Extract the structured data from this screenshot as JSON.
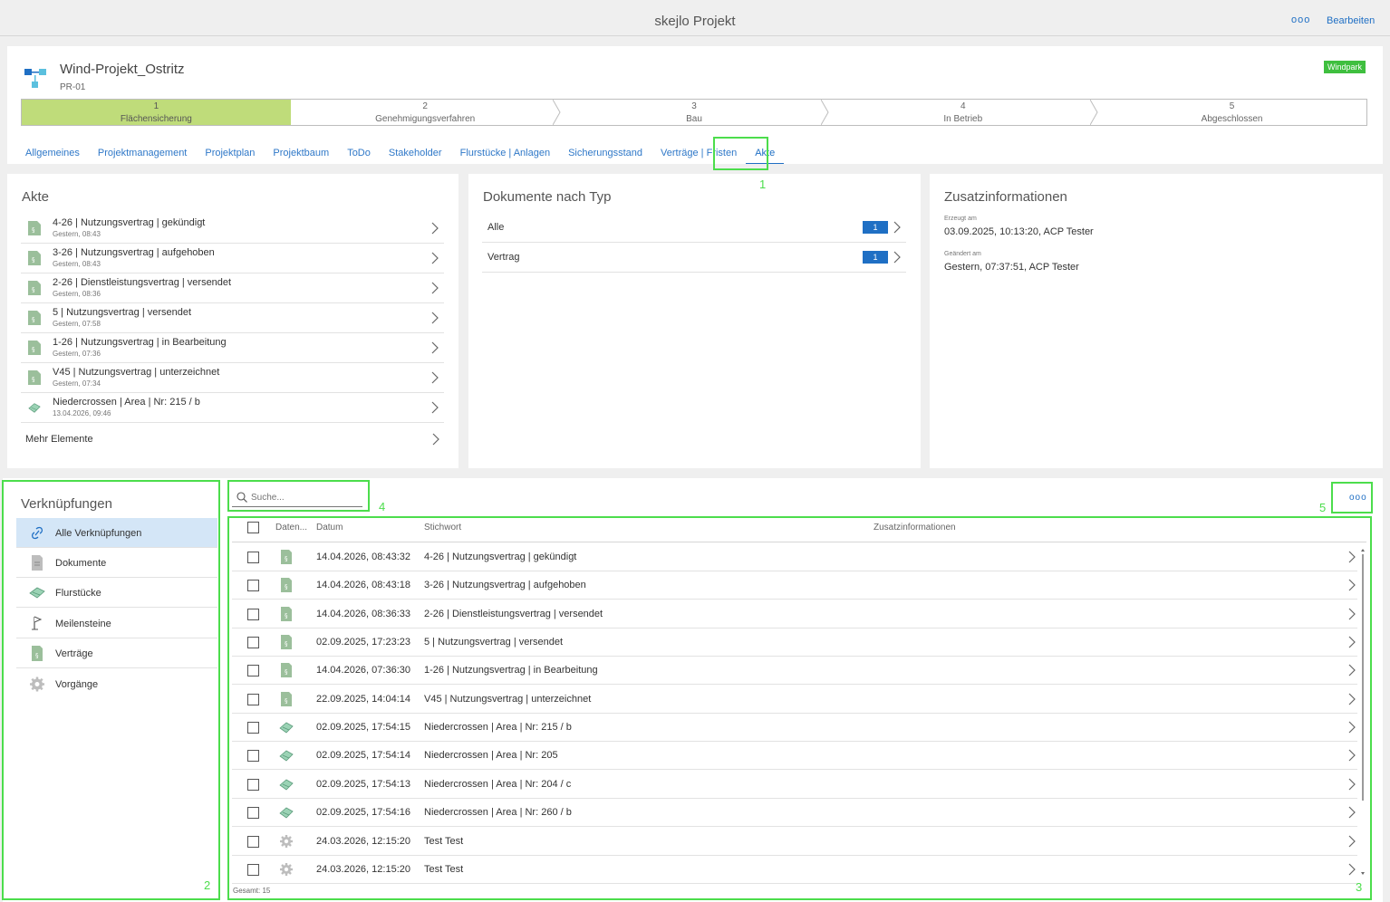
{
  "app": {
    "title": "skejlo Projekt",
    "more_label": "ooo",
    "edit_label": "Bearbeiten"
  },
  "project": {
    "name": "Wind-Projekt_Ostritz",
    "id": "PR-01",
    "badge": "Windpark",
    "badge_color": "#3fbf3f"
  },
  "phases": [
    {
      "num": "1",
      "label": "Flächensicherung",
      "active": true
    },
    {
      "num": "2",
      "label": "Genehmigungsverfahren"
    },
    {
      "num": "3",
      "label": "Bau"
    },
    {
      "num": "4",
      "label": "In Betrieb"
    },
    {
      "num": "5",
      "label": "Abgeschlossen"
    }
  ],
  "tabs": [
    "Allgemeines",
    "Projektmanagement",
    "Projektplan",
    "Projektbaum",
    "ToDo",
    "Stakeholder",
    "Flurstücke | Anlagen",
    "Sicherungsstand",
    "Verträge | Fristen",
    "Akte"
  ],
  "annotations": [
    "1",
    "2",
    "3",
    "4",
    "5"
  ],
  "akte": {
    "title": "Akte",
    "items": [
      {
        "icon": "contract-icon",
        "main": "4-26 | Nutzungsvertrag | gekündigt",
        "sub": "Gestern, 08:43"
      },
      {
        "icon": "contract-icon",
        "main": "3-26 | Nutzungsvertrag | aufgehoben",
        "sub": "Gestern, 08:43"
      },
      {
        "icon": "contract-icon",
        "main": "2-26 | Dienstleistungsvertrag | versendet",
        "sub": "Gestern, 08:36"
      },
      {
        "icon": "contract-icon",
        "main": "5 | Nutzungsvertrag | versendet",
        "sub": "Gestern, 07:58"
      },
      {
        "icon": "contract-icon",
        "main": "1-26 | Nutzungsvertrag | in Bearbeitung",
        "sub": "Gestern, 07:36"
      },
      {
        "icon": "contract-icon",
        "main": "V45 | Nutzungsvertrag | unterzeichnet",
        "sub": "Gestern, 07:34"
      },
      {
        "icon": "parcel-icon",
        "main": "Niedercrossen | Area | Nr: 215 / b",
        "sub": "13.04.2026, 09:46"
      }
    ],
    "more_label": "Mehr Elemente"
  },
  "doc_types": {
    "title": "Dokumente nach Typ",
    "rows": [
      {
        "label": "Alle",
        "count": "1"
      },
      {
        "label": "Vertrag",
        "count": "1"
      }
    ]
  },
  "extra_info": {
    "title": "Zusatzinformationen",
    "created_label": "Erzeugt am",
    "created_value": "03.09.2025, 10:13:20, ACP Tester",
    "changed_label": "Geändert am",
    "changed_value": "Gestern, 07:37:51, ACP Tester"
  },
  "links": {
    "title": "Verknüpfungen",
    "items": [
      {
        "icon": "link-icon",
        "label": "Alle Verknüpfungen",
        "selected": true
      },
      {
        "icon": "document-icon",
        "label": "Dokumente"
      },
      {
        "icon": "parcel-icon",
        "label": "Flurstücke"
      },
      {
        "icon": "milestone-flag-icon",
        "label": "Meilensteine"
      },
      {
        "icon": "contract-icon",
        "label": "Verträge"
      },
      {
        "icon": "gear-icon",
        "label": "Vorgänge"
      }
    ]
  },
  "table": {
    "search_placeholder": "Suche...",
    "more_label": "ooo",
    "columns": [
      "Daten...",
      "Datum",
      "Stichwort",
      "Zusatzinformationen"
    ],
    "rows": [
      {
        "icon": "contract-icon",
        "date": "14.04.2026, 08:43:32",
        "keyword": "4-26 | Nutzungsvertrag | gekündigt"
      },
      {
        "icon": "contract-icon",
        "date": "14.04.2026, 08:43:18",
        "keyword": "3-26 | Nutzungsvertrag | aufgehoben"
      },
      {
        "icon": "contract-icon",
        "date": "14.04.2026, 08:36:33",
        "keyword": "2-26 | Dienstleistungsvertrag | versendet"
      },
      {
        "icon": "contract-icon",
        "date": "02.09.2025, 17:23:23",
        "keyword": "5 | Nutzungsvertrag | versendet"
      },
      {
        "icon": "contract-icon",
        "date": "14.04.2026, 07:36:30",
        "keyword": "1-26 | Nutzungsvertrag | in Bearbeitung"
      },
      {
        "icon": "contract-icon",
        "date": "22.09.2025, 14:04:14",
        "keyword": "V45 | Nutzungsvertrag | unterzeichnet"
      },
      {
        "icon": "parcel-icon",
        "date": "02.09.2025, 17:54:15",
        "keyword": "Niedercrossen | Area | Nr: 215 / b"
      },
      {
        "icon": "parcel-icon",
        "date": "02.09.2025, 17:54:14",
        "keyword": "Niedercrossen | Area | Nr: 205"
      },
      {
        "icon": "parcel-icon",
        "date": "02.09.2025, 17:54:13",
        "keyword": "Niedercrossen | Area | Nr: 204 / c"
      },
      {
        "icon": "parcel-icon",
        "date": "02.09.2025, 17:54:16",
        "keyword": "Niedercrossen | Area | Nr: 260 / b"
      },
      {
        "icon": "gear-icon",
        "date": "24.03.2026, 12:15:20",
        "keyword": "Test Test"
      },
      {
        "icon": "gear-icon",
        "date": "24.03.2026, 12:15:20",
        "keyword": "Test Test"
      }
    ],
    "total": "Gesamt: 15"
  }
}
